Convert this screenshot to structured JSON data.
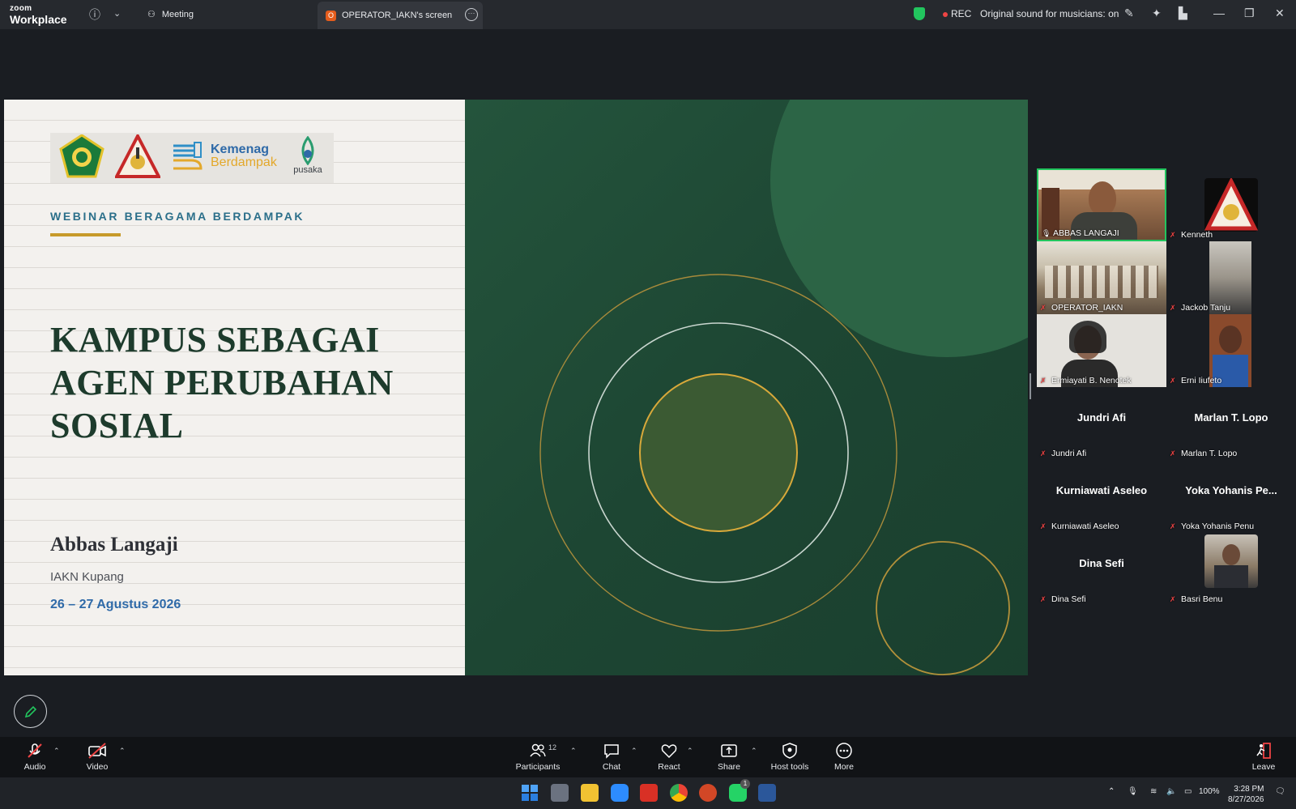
{
  "app": {
    "brand_top": "zoom",
    "brand_bottom": "Workplace"
  },
  "titlebar": {
    "meeting_label": "Meeting",
    "share_tab_label": "OPERATOR_IAKN's screen",
    "share_tab_badge": "O",
    "rec_label": "REC",
    "original_sound": "Original sound for musicians: on"
  },
  "slide": {
    "eyebrow": "WEBINAR BERAGAMA BERDAMPAK",
    "headline_line1": "KAMPUS SEBAGAI",
    "headline_line2": "AGEN PERUBAHAN",
    "headline_line3": "SOSIAL",
    "speaker": "Abbas Langaji",
    "institution": "IAKN Kupang",
    "dates": "26 – 27 Agustus 2026",
    "logo_kemenag_line1": "Kemenag",
    "logo_kemenag_line2": "Berdampak",
    "logo_pusaka": "pusaka"
  },
  "gallery": {
    "participants": [
      {
        "name": "ABBAS LANGAJI"
      },
      {
        "name": "Kenneth"
      },
      {
        "name": "OPERATOR_IAKN"
      },
      {
        "name": "Jackob Tanju"
      },
      {
        "name": "Ermiayati B. Nenotek"
      },
      {
        "name": "Erni Iiufeto"
      },
      {
        "name": "Jundri Afi",
        "display": "Jundri Afi"
      },
      {
        "name": "Marlan T. Lopo",
        "display": "Marlan T. Lopo"
      },
      {
        "name": "Kurniawati Aseleo",
        "display": "Kurniawati Aseleo"
      },
      {
        "name": "Yoka Yohanis Penu",
        "display": "Yoka Yohanis Pe..."
      },
      {
        "name": "Dina Sefi",
        "display": "Dina Sefi"
      },
      {
        "name": "Basri Benu"
      }
    ]
  },
  "toolbar": {
    "audio": "Audio",
    "video": "Video",
    "participants": "Participants",
    "participants_count": "12",
    "chat": "Chat",
    "react": "React",
    "share": "Share",
    "host_tools": "Host tools",
    "more": "More",
    "leave": "Leave"
  },
  "taskbar": {
    "battery": "100%",
    "time": "3:28 PM",
    "date": "8/27/2026",
    "whatsapp_badge": "1"
  },
  "colors": {
    "slide_green": "#1f4a35",
    "gold": "#c79a2b",
    "accent_blue": "#2f6aa8",
    "active_speaker": "#22c55e",
    "muted_red": "#ef4444"
  }
}
